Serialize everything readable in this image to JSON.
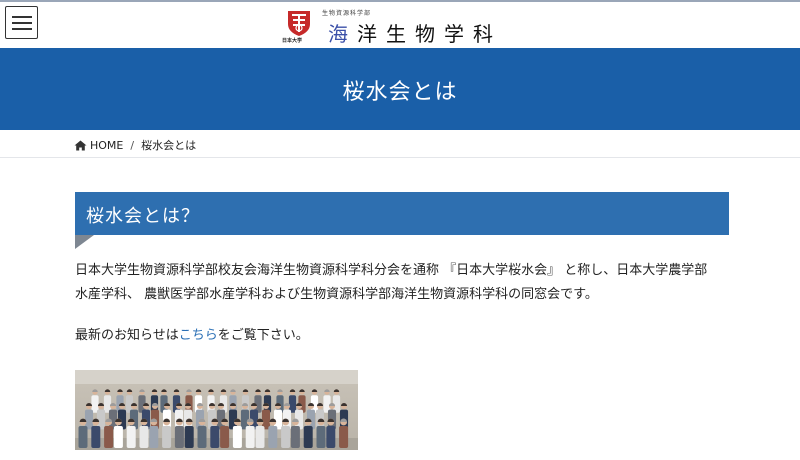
{
  "header": {
    "faculty_small": "生物資源科学部",
    "university_small": "日本大学",
    "department_first": "海",
    "department_rest": "洋生物学科"
  },
  "hero": {
    "title": "桜水会とは"
  },
  "breadcrumb": {
    "home": "HOME",
    "separator": "/",
    "current": "桜水会とは"
  },
  "section": {
    "heading": "桜水会とは？"
  },
  "body": {
    "paragraph1_line1": "日本大学生物資源科学部校友会海洋生物資源科学科分会を通称 『日本大学桜水会』 と称し、日本大学農学部",
    "paragraph1_line2": "水産学科、 農獣医学部水産学科および生物資源科学部海洋生物資源科学科の同窓会です。",
    "news_before": "最新のお知らせは",
    "news_link": "こちら",
    "news_after": "をご覧下さい。"
  },
  "colors": {
    "hero_blue": "#1a5fa8",
    "section_blue": "#2e6fb0",
    "link": "#2a6fb5",
    "tab_grey": "#7e8792"
  },
  "icons": [
    "menu-icon",
    "crest-icon",
    "home-icon"
  ],
  "photo": {
    "subject": "group-photo"
  }
}
